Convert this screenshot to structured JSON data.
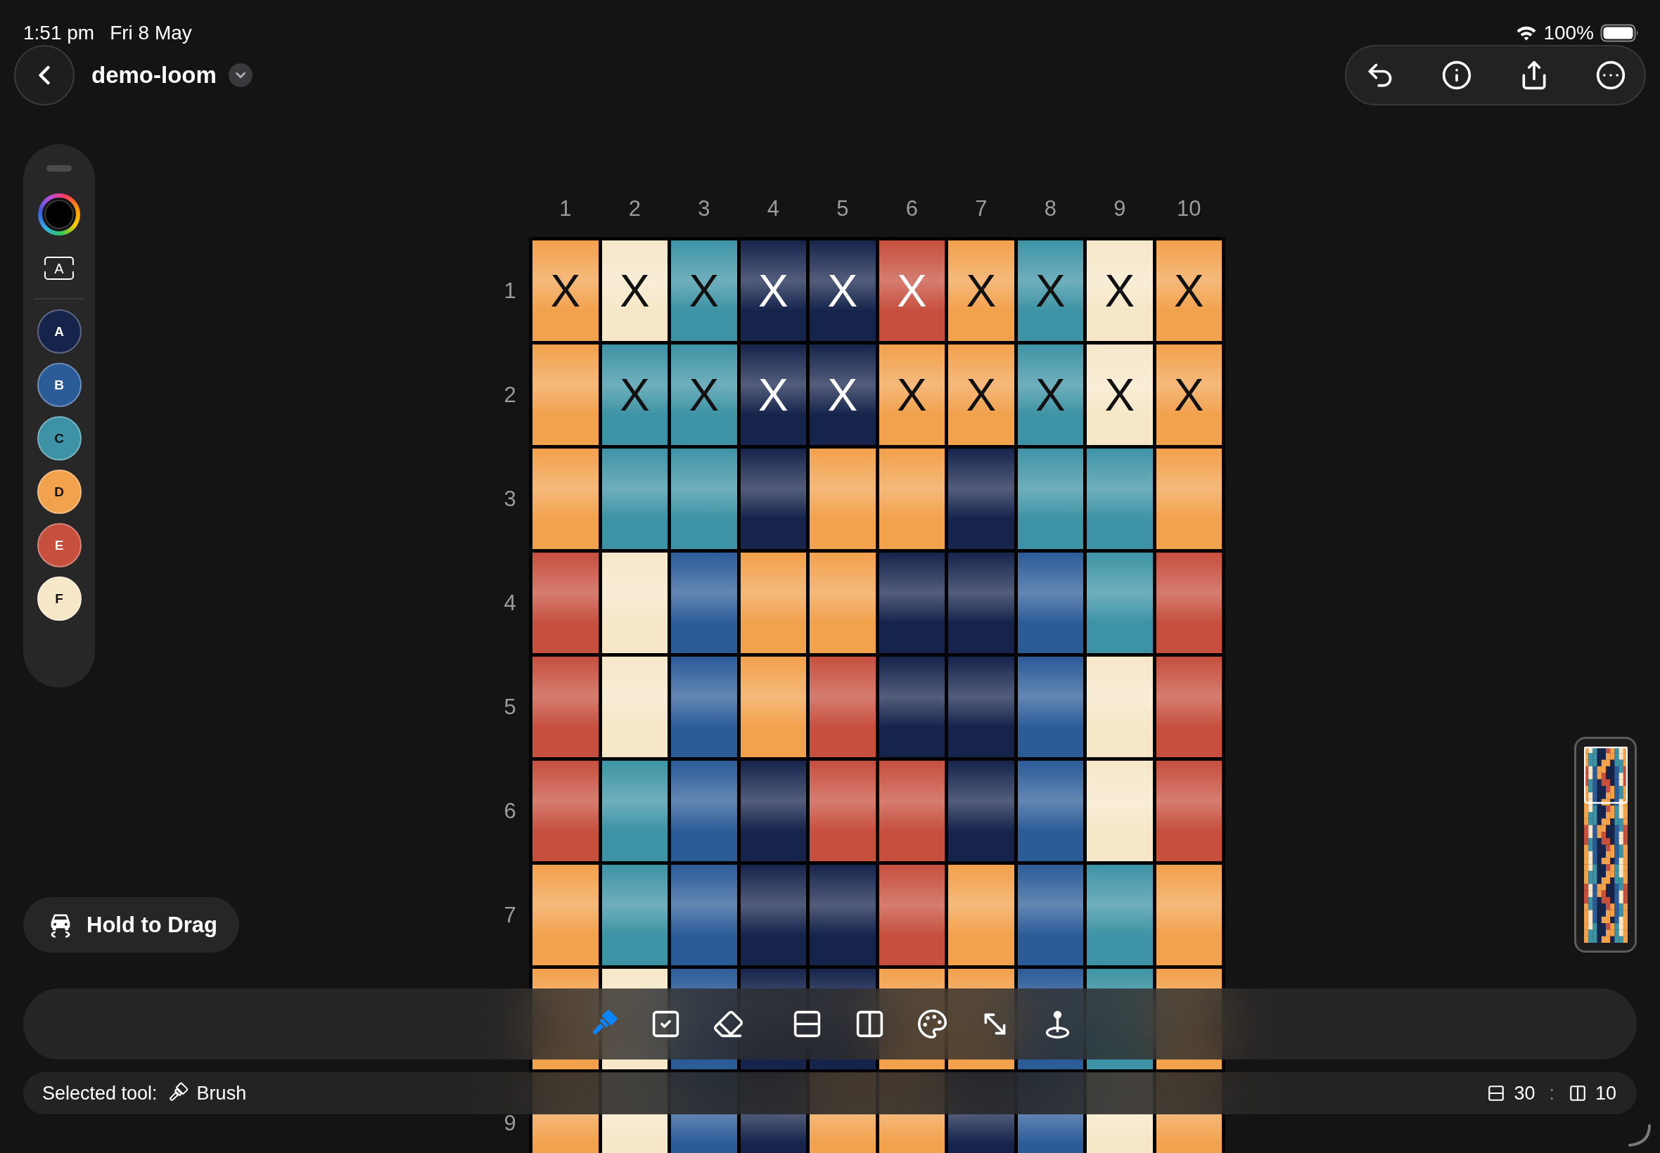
{
  "status_bar": {
    "time": "1:51 pm",
    "date": "Fri 8 May",
    "battery": "100%"
  },
  "header": {
    "title": "demo-loom"
  },
  "palette": {
    "letters_toggle": "A",
    "swatches": [
      {
        "letter": "A",
        "color": "#16244c"
      },
      {
        "letter": "B",
        "color": "#2c5c98"
      },
      {
        "letter": "C",
        "color": "#3d93a5"
      },
      {
        "letter": "D",
        "color": "#f2a14c"
      },
      {
        "letter": "E",
        "color": "#c64f3e"
      },
      {
        "letter": "F",
        "color": "#f6e7c8"
      }
    ]
  },
  "grid": {
    "columns": [
      "1",
      "2",
      "3",
      "4",
      "5",
      "6",
      "7",
      "8",
      "9",
      "10"
    ],
    "rows": [
      {
        "label": "1",
        "cells": [
          {
            "color": "#f2a14c",
            "symbol": "X"
          },
          {
            "color": "#f6e7c8",
            "symbol": "X"
          },
          {
            "color": "#3d93a5",
            "symbol": "X"
          },
          {
            "color": "#16244c",
            "symbol": "X"
          },
          {
            "color": "#16244c",
            "symbol": "X"
          },
          {
            "color": "#c64f3e",
            "symbol": "X"
          },
          {
            "color": "#f2a14c",
            "symbol": "X"
          },
          {
            "color": "#3d93a5",
            "symbol": "X"
          },
          {
            "color": "#f6e7c8",
            "symbol": "X"
          },
          {
            "color": "#f2a14c",
            "symbol": "X"
          }
        ]
      },
      {
        "label": "2",
        "cells": [
          {
            "color": "#f2a14c"
          },
          {
            "color": "#3d93a5",
            "symbol": "X"
          },
          {
            "color": "#3d93a5",
            "symbol": "X"
          },
          {
            "color": "#16244c",
            "symbol": "X"
          },
          {
            "color": "#16244c",
            "symbol": "X"
          },
          {
            "color": "#f2a14c",
            "symbol": "X"
          },
          {
            "color": "#f2a14c",
            "symbol": "X"
          },
          {
            "color": "#3d93a5",
            "symbol": "X"
          },
          {
            "color": "#f6e7c8",
            "symbol": "X"
          },
          {
            "color": "#f2a14c",
            "symbol": "X"
          }
        ]
      },
      {
        "label": "3",
        "cells": [
          {
            "color": "#f2a14c"
          },
          {
            "color": "#3d93a5"
          },
          {
            "color": "#3d93a5"
          },
          {
            "color": "#16244c"
          },
          {
            "color": "#f2a14c"
          },
          {
            "color": "#f2a14c"
          },
          {
            "color": "#16244c"
          },
          {
            "color": "#3d93a5"
          },
          {
            "color": "#3d93a5"
          },
          {
            "color": "#f2a14c"
          }
        ]
      },
      {
        "label": "4",
        "cells": [
          {
            "color": "#c64f3e"
          },
          {
            "color": "#f6e7c8"
          },
          {
            "color": "#2c5c98"
          },
          {
            "color": "#f2a14c"
          },
          {
            "color": "#f2a14c"
          },
          {
            "color": "#16244c"
          },
          {
            "color": "#16244c"
          },
          {
            "color": "#2c5c98"
          },
          {
            "color": "#3d93a5"
          },
          {
            "color": "#c64f3e"
          }
        ]
      },
      {
        "label": "5",
        "cells": [
          {
            "color": "#c64f3e"
          },
          {
            "color": "#f6e7c8"
          },
          {
            "color": "#2c5c98"
          },
          {
            "color": "#f2a14c"
          },
          {
            "color": "#c64f3e"
          },
          {
            "color": "#16244c"
          },
          {
            "color": "#16244c"
          },
          {
            "color": "#2c5c98"
          },
          {
            "color": "#f6e7c8"
          },
          {
            "color": "#c64f3e"
          }
        ]
      },
      {
        "label": "6",
        "cells": [
          {
            "color": "#c64f3e"
          },
          {
            "color": "#3d93a5"
          },
          {
            "color": "#2c5c98"
          },
          {
            "color": "#16244c"
          },
          {
            "color": "#c64f3e"
          },
          {
            "color": "#c64f3e"
          },
          {
            "color": "#16244c"
          },
          {
            "color": "#2c5c98"
          },
          {
            "color": "#f6e7c8"
          },
          {
            "color": "#c64f3e"
          }
        ]
      },
      {
        "label": "7",
        "cells": [
          {
            "color": "#f2a14c"
          },
          {
            "color": "#3d93a5"
          },
          {
            "color": "#2c5c98"
          },
          {
            "color": "#16244c"
          },
          {
            "color": "#16244c"
          },
          {
            "color": "#c64f3e"
          },
          {
            "color": "#f2a14c"
          },
          {
            "color": "#2c5c98"
          },
          {
            "color": "#3d93a5"
          },
          {
            "color": "#f2a14c"
          }
        ]
      },
      {
        "cells": [
          {
            "color": "#f2a14c"
          },
          {
            "color": "#f6e7c8"
          },
          {
            "color": "#2c5c98"
          },
          {
            "color": "#16244c"
          },
          {
            "color": "#16244c"
          },
          {
            "color": "#f2a14c"
          },
          {
            "color": "#f2a14c"
          },
          {
            "color": "#2c5c98"
          },
          {
            "color": "#3d93a5"
          },
          {
            "color": "#f2a14c"
          }
        ]
      },
      {
        "label": "9",
        "cells": [
          {
            "color": "#f2a14c"
          },
          {
            "color": "#f6e7c8"
          },
          {
            "color": "#2c5c98"
          },
          {
            "color": "#16244c"
          },
          {
            "color": "#f2a14c"
          },
          {
            "color": "#f2a14c"
          },
          {
            "color": "#16244c"
          },
          {
            "color": "#2c5c98"
          },
          {
            "color": "#f6e7c8"
          },
          {
            "color": "#f2a14c"
          }
        ]
      }
    ]
  },
  "drag_button": {
    "label": "Hold to Drag"
  },
  "toolbar": {
    "groups": [
      {
        "tools": [
          {
            "selected": true
          },
          {
            "selected": false
          },
          {
            "selected": false
          }
        ]
      },
      {
        "tools": [
          {
            "selected": false
          },
          {
            "selected": false
          },
          {
            "selected": false
          },
          {
            "selected": false
          },
          {
            "selected": false
          }
        ]
      }
    ]
  },
  "tool_status": {
    "label": "Selected tool:",
    "tool": "Brush",
    "rows": "30",
    "separator": ":",
    "columns": "10"
  }
}
